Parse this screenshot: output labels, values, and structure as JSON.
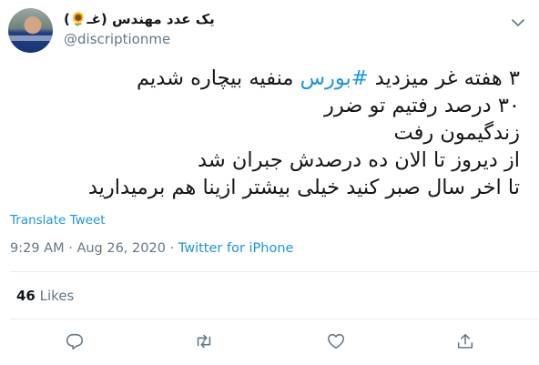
{
  "author": {
    "display_name": "یک عدد مهندس (غـ🌻)",
    "handle": "@discriptionme",
    "avatar_icon": "avatar"
  },
  "tweet": {
    "line1_part1": "۳ هفته غر میزدید ",
    "line1_hashtag": "#بورس",
    "line1_part2": " منفیه بیچاره شدیم",
    "line2": "۳۰ درصد رفتیم تو ضرر",
    "line3": "زندگیمون رفت",
    "line4": "از دیروز تا الان ده درصدش جبران شد",
    "line5": "تا اخر سال صبر کنید خیلی بیشتر ازینا هم برمیدارید"
  },
  "translate_label": "Translate Tweet",
  "meta": {
    "time": "9:29 AM",
    "separator": "·",
    "date": "Aug 26, 2020",
    "source": "Twitter for iPhone"
  },
  "likes": {
    "count": "46",
    "label": "Likes"
  },
  "colors": {
    "accent": "#1b95e0",
    "muted": "#657786",
    "text": "#14171a"
  },
  "icons": [
    "chevron-down-icon",
    "reply-icon",
    "retweet-icon",
    "like-icon",
    "share-icon"
  ]
}
